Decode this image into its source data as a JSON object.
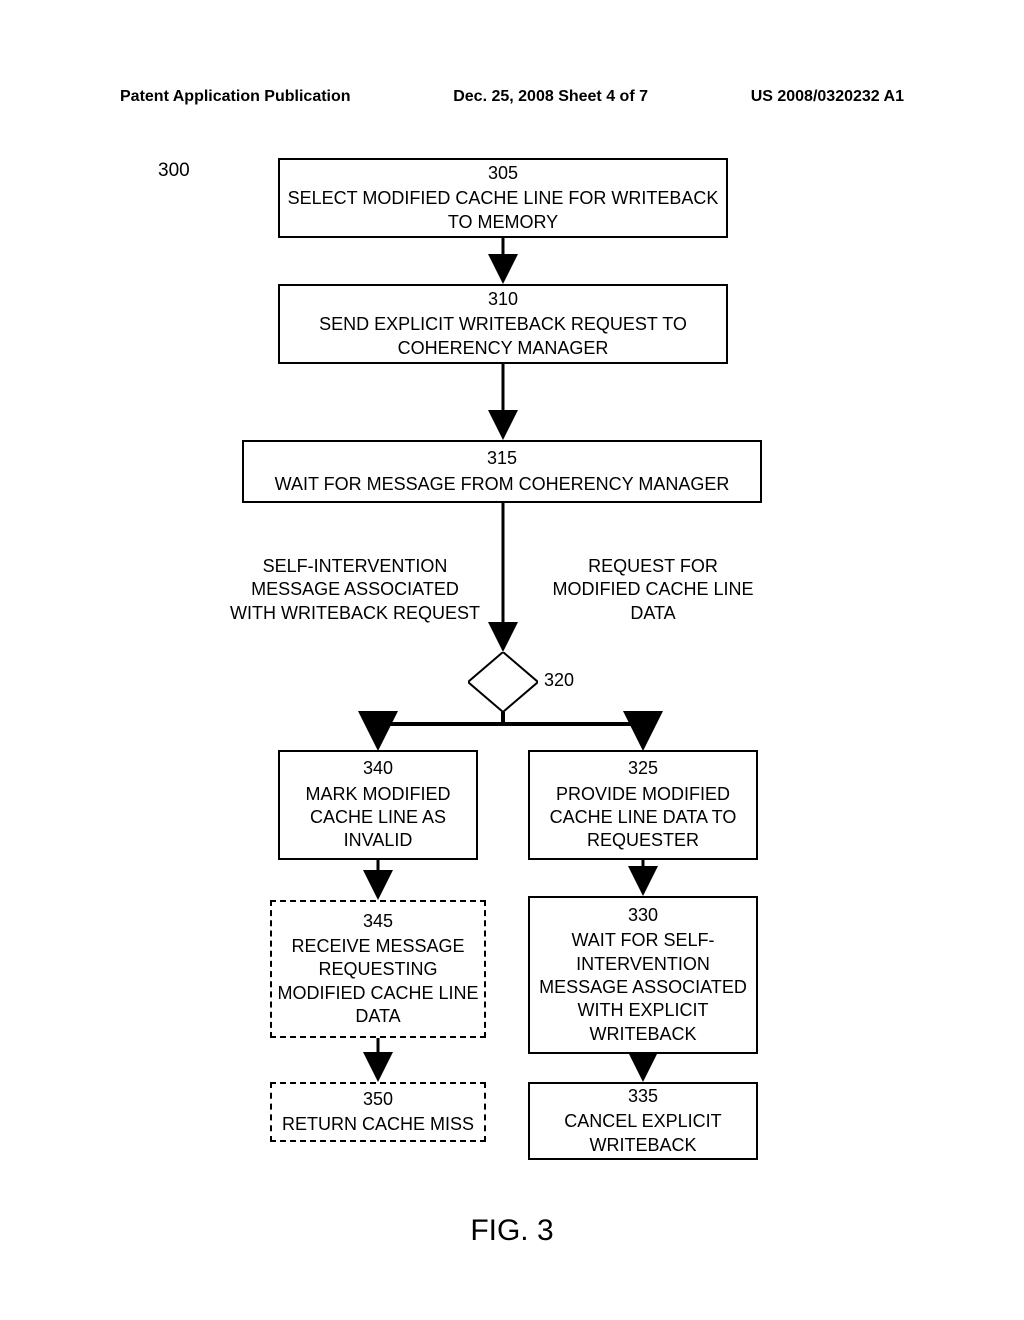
{
  "header": {
    "left": "Patent Application Publication",
    "center": "Dec. 25, 2008  Sheet 4 of 7",
    "right": "US 2008/0320232 A1"
  },
  "ref300": "300",
  "boxes": {
    "b305": {
      "num": "305",
      "text": "SELECT MODIFIED CACHE LINE FOR WRITEBACK TO MEMORY"
    },
    "b310": {
      "num": "310",
      "text": "SEND EXPLICIT WRITEBACK REQUEST TO COHERENCY MANAGER"
    },
    "b315": {
      "num": "315",
      "text": "WAIT FOR MESSAGE FROM COHERENCY MANAGER"
    },
    "b320": {
      "num": "320"
    },
    "b325": {
      "num": "325",
      "text": "PROVIDE MODIFIED CACHE LINE DATA TO REQUESTER"
    },
    "b330": {
      "num": "330",
      "text": "WAIT FOR SELF-INTERVENTION MESSAGE ASSOCIATED WITH EXPLICIT WRITEBACK"
    },
    "b335": {
      "num": "335",
      "text": "CANCEL EXPLICIT WRITEBACK"
    },
    "b340": {
      "num": "340",
      "text": "MARK MODIFIED CACHE LINE AS INVALID"
    },
    "b345": {
      "num": "345",
      "text": "RECEIVE MESSAGE REQUESTING MODIFIED CACHE LINE DATA"
    },
    "b350": {
      "num": "350",
      "text": "RETURN CACHE MISS"
    }
  },
  "branch_labels": {
    "left": "SELF-INTERVENTION MESSAGE ASSOCIATED WITH WRITEBACK REQUEST",
    "right": "REQUEST FOR MODIFIED CACHE LINE DATA"
  },
  "figure_label": "FIG. 3",
  "chart_data": {
    "type": "flowchart",
    "title": "FIG. 3",
    "reference_numeral": "300",
    "nodes": [
      {
        "id": "305",
        "type": "process",
        "text": "SELECT MODIFIED CACHE LINE FOR WRITEBACK TO MEMORY"
      },
      {
        "id": "310",
        "type": "process",
        "text": "SEND EXPLICIT WRITEBACK REQUEST TO COHERENCY MANAGER"
      },
      {
        "id": "315",
        "type": "process",
        "text": "WAIT FOR MESSAGE FROM COHERENCY MANAGER"
      },
      {
        "id": "320",
        "type": "decision",
        "text": ""
      },
      {
        "id": "325",
        "type": "process",
        "text": "PROVIDE MODIFIED CACHE LINE DATA TO REQUESTER"
      },
      {
        "id": "330",
        "type": "process",
        "text": "WAIT FOR SELF-INTERVENTION MESSAGE ASSOCIATED WITH EXPLICIT WRITEBACK"
      },
      {
        "id": "335",
        "type": "process",
        "text": "CANCEL EXPLICIT WRITEBACK"
      },
      {
        "id": "340",
        "type": "process",
        "text": "MARK MODIFIED CACHE LINE AS INVALID"
      },
      {
        "id": "345",
        "type": "process",
        "style": "dashed",
        "text": "RECEIVE MESSAGE REQUESTING MODIFIED CACHE LINE DATA"
      },
      {
        "id": "350",
        "type": "process",
        "style": "dashed",
        "text": "RETURN CACHE MISS"
      }
    ],
    "edges": [
      {
        "from": "305",
        "to": "310"
      },
      {
        "from": "310",
        "to": "315"
      },
      {
        "from": "315",
        "to": "320"
      },
      {
        "from": "320",
        "to": "340",
        "label": "SELF-INTERVENTION MESSAGE ASSOCIATED WITH WRITEBACK REQUEST"
      },
      {
        "from": "320",
        "to": "325",
        "label": "REQUEST FOR MODIFIED CACHE LINE DATA"
      },
      {
        "from": "325",
        "to": "330"
      },
      {
        "from": "330",
        "to": "335"
      },
      {
        "from": "340",
        "to": "345"
      },
      {
        "from": "345",
        "to": "350"
      }
    ]
  }
}
